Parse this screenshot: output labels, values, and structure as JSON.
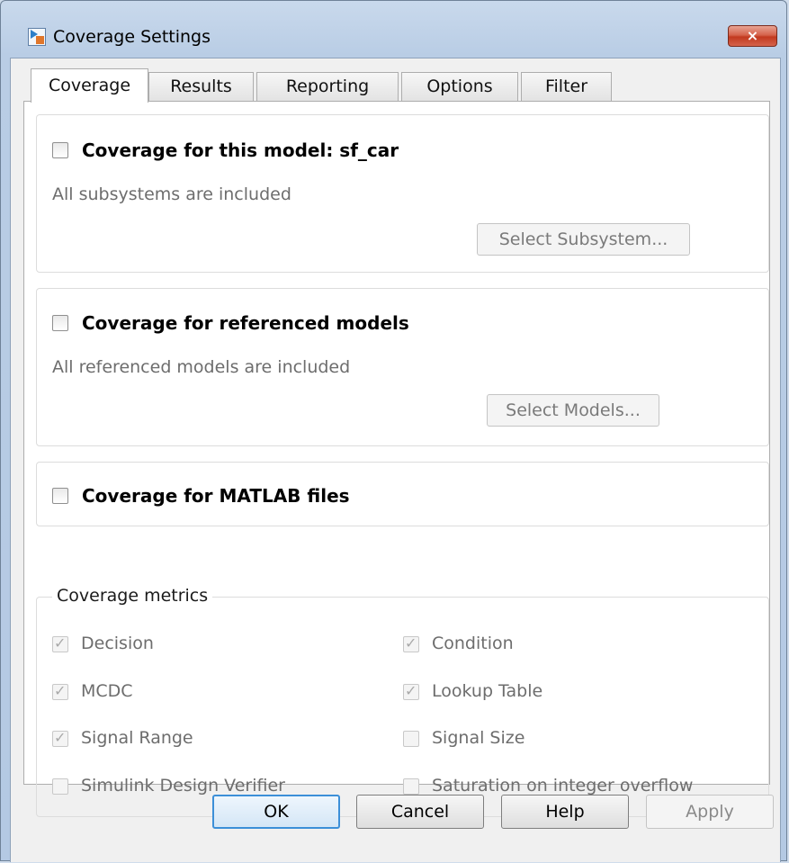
{
  "window": {
    "title": "Coverage Settings",
    "close_icon": "×"
  },
  "tabs": [
    {
      "label": "Coverage",
      "active": true
    },
    {
      "label": "Results"
    },
    {
      "label": "Reporting"
    },
    {
      "label": "Options"
    },
    {
      "label": "Filter"
    }
  ],
  "model_group": {
    "checkbox_label": "Coverage for this model: sf_car",
    "checked": false,
    "status": "All subsystems are included",
    "button_label": "Select Subsystem..."
  },
  "ref_group": {
    "checkbox_label": "Coverage for referenced models",
    "checked": false,
    "status": "All referenced models are included",
    "button_label": "Select Models..."
  },
  "matlab_group": {
    "checkbox_label": "Coverage for MATLAB files",
    "checked": false
  },
  "metrics": {
    "title": "Coverage metrics",
    "check_glyph": "✓",
    "items": [
      {
        "label": "Decision",
        "checked": true
      },
      {
        "label": "Condition",
        "checked": true
      },
      {
        "label": "MCDC",
        "checked": true
      },
      {
        "label": "Lookup Table",
        "checked": true
      },
      {
        "label": "Signal Range",
        "checked": true
      },
      {
        "label": "Signal Size",
        "checked": false
      },
      {
        "label": "Simulink Design Verifier",
        "checked": false
      },
      {
        "label": "Saturation on integer overflow",
        "checked": false
      }
    ]
  },
  "buttons": {
    "ok": "OK",
    "cancel": "Cancel",
    "help": "Help",
    "apply": "Apply"
  }
}
